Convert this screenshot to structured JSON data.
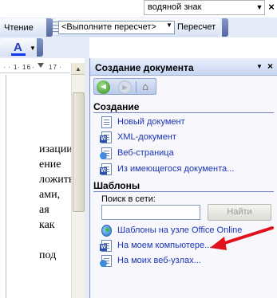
{
  "search_box": {
    "value": "водяной знак"
  },
  "toolbar": {
    "reading_label": "Чтение",
    "recalc_combo_value": "<Выполните пересчет>",
    "recalc_label": "Пересчет",
    "font_color_glyph": "A",
    "font_color_accent": "#1133ee"
  },
  "ruler": {
    "marks": [
      "1",
      "16",
      "17"
    ]
  },
  "document": {
    "lines": [
      "изации",
      "ение",
      "ложить",
      "ами,",
      "ая",
      "как",
      "",
      "под"
    ]
  },
  "task_pane": {
    "title": "Создание документа",
    "sections": {
      "create": {
        "title": "Создание",
        "items": [
          {
            "label": "Новый документ",
            "icon": "blank-document-icon"
          },
          {
            "label": "XML-документ",
            "icon": "xml-document-icon"
          },
          {
            "label": "Веб-страница",
            "icon": "web-page-icon"
          },
          {
            "label": "Из имеющегося документа...",
            "icon": "existing-document-icon"
          }
        ]
      },
      "templates": {
        "title": "Шаблоны",
        "search_label": "Поиск в сети:",
        "search_value": "",
        "go_button": "Найти",
        "items": [
          {
            "label": "Шаблоны на узле Office Online",
            "icon": "office-online-globe-icon"
          },
          {
            "label": "На моем компьютере...",
            "icon": "word-templates-icon"
          },
          {
            "label": "На моих веб-узлах...",
            "icon": "web-sites-icon"
          }
        ]
      }
    }
  },
  "annotation": {
    "color": "#e0121b"
  }
}
